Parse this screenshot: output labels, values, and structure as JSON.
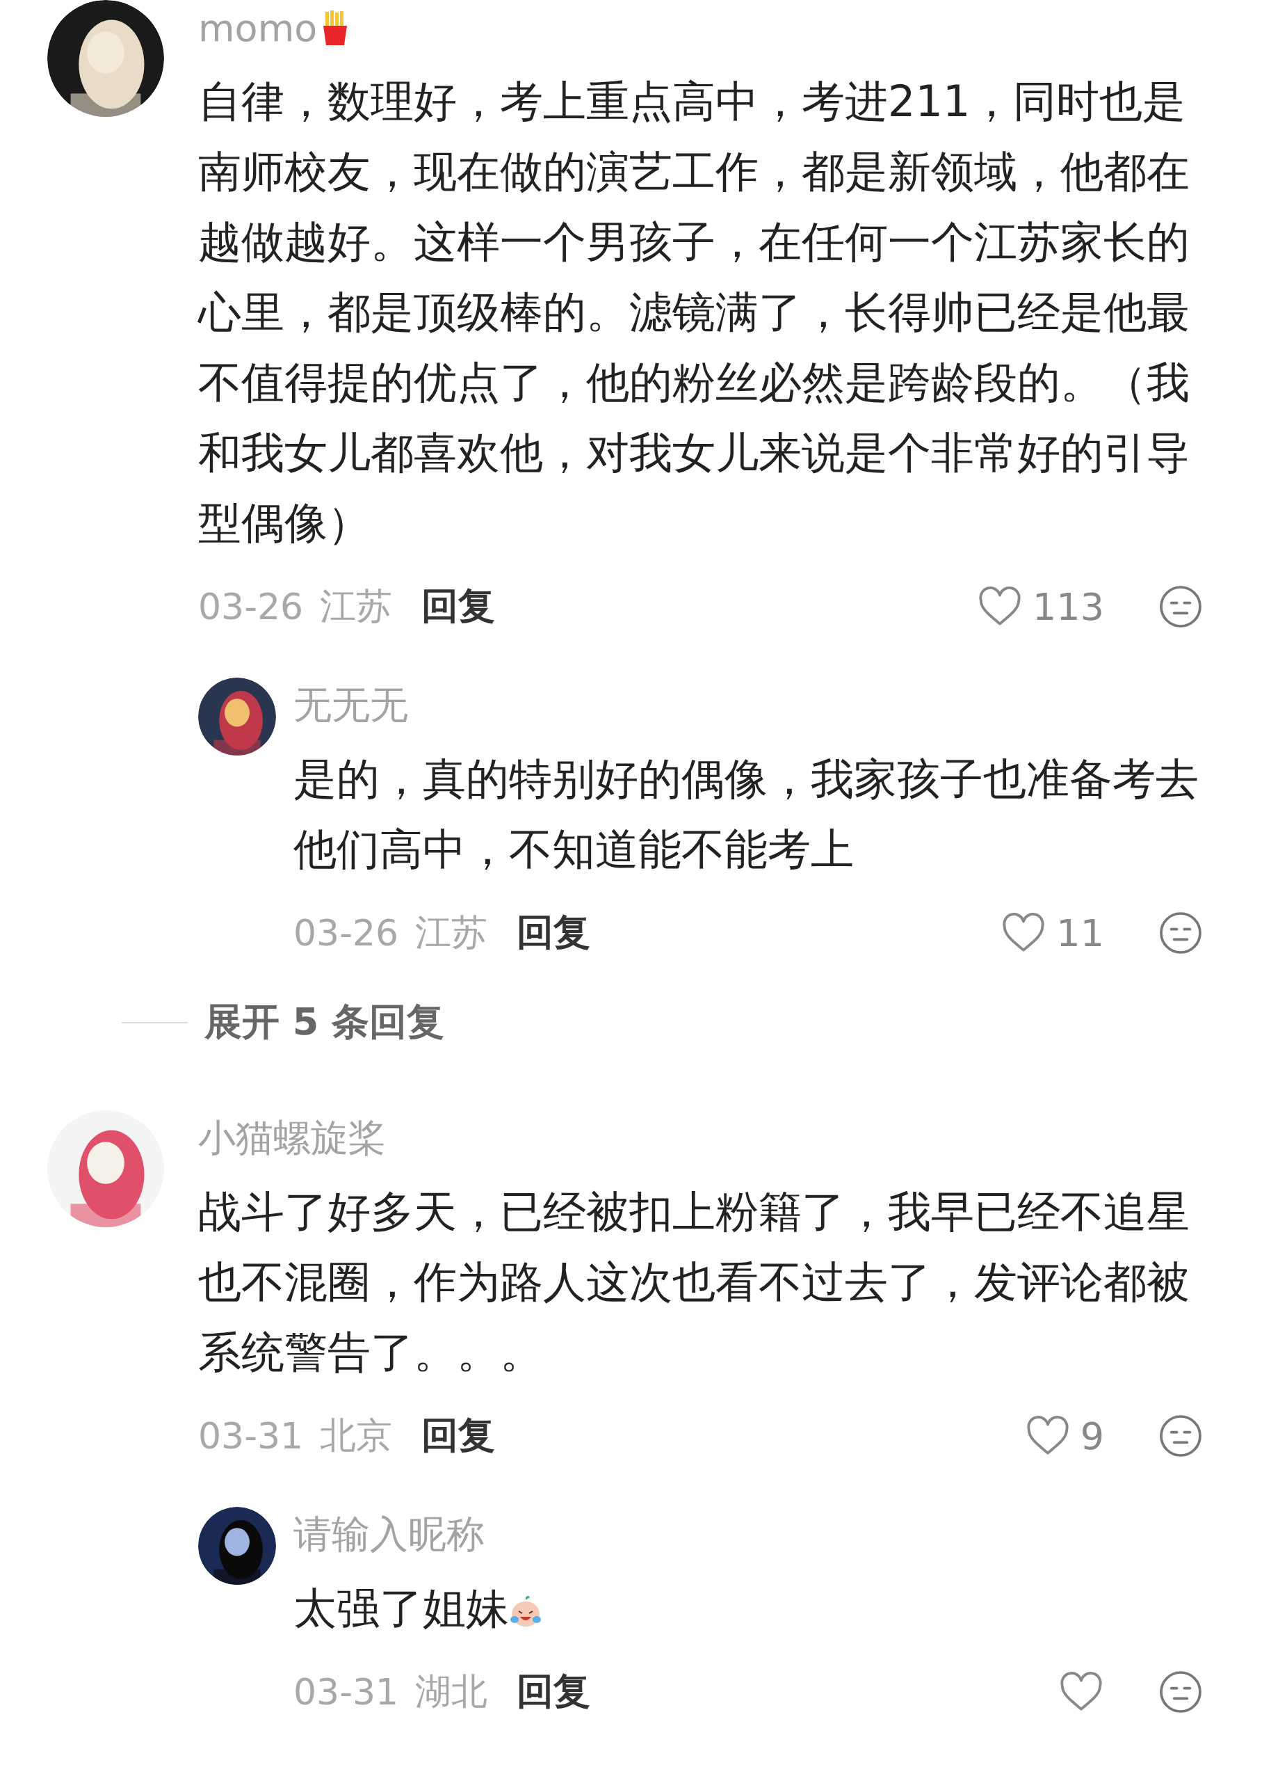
{
  "comments": [
    {
      "user": "momo",
      "name_emoji": true,
      "text": "自律，数理好，考上重点高中，考进211，同时也是南师校友，现在做的演艺工作，都是新领域，他都在越做越好。这样一个男孩子，在任何一个江苏家长的心里，都是顶级棒的。滤镜满了，长得帅已经是他最不值得提的优点了，他的粉丝必然是跨龄段的。（我和我女儿都喜欢他，对我女儿来说是个非常好的引导型偶像）",
      "date": "03-26",
      "region": "江苏",
      "reply_label": "回复",
      "likes": "113",
      "replies": [
        {
          "user": "无无无",
          "text": "是的，真的特别好的偶像，我家孩子也准备考去他们高中，不知道能不能考上",
          "date": "03-26",
          "region": "江苏",
          "reply_label": "回复",
          "likes": "11"
        }
      ],
      "expand": "展开 5 条回复"
    },
    {
      "user": "小猫螺旋桨",
      "text": "战斗了好多天，已经被扣上粉籍了，我早已经不追星也不混圈，作为路人这次也看不过去了，发评论都被系统警告了。。。",
      "date": "03-31",
      "region": "北京",
      "reply_label": "回复",
      "likes": "9",
      "replies": [
        {
          "user": "请输入昵称",
          "text_emoji": true,
          "text": "太强了姐妹",
          "date": "03-31",
          "region": "湖北",
          "reply_label": "回复"
        }
      ]
    }
  ]
}
